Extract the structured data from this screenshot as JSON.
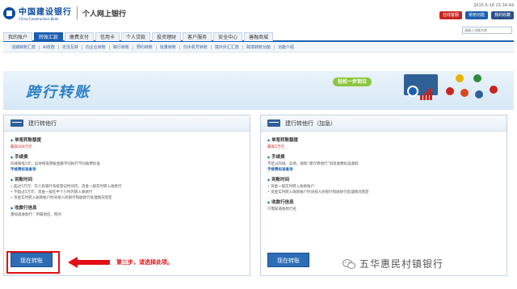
{
  "header": {
    "bank_name_cn": "中国建设银行",
    "bank_name_en": "China Construction Bank",
    "portal_title": "个人网上银行",
    "date": "2015-5-18 15:34:49",
    "buttons": [
      "在线客服",
      "常用功能",
      "我的收藏"
    ]
  },
  "nav": {
    "tabs": [
      "我的账户",
      "转账汇款",
      "缴费支付",
      "信用卡",
      "个人贷款",
      "投资理财",
      "客户服务",
      "安全中心",
      "善融商城"
    ],
    "active_index": 1,
    "search_placeholder": "请输入功能名称"
  },
  "subnav": {
    "items": [
      "活期转账汇款",
      "Al收款",
      "定活互转",
      "向企业转账",
      "跨行转账",
      "预约转账",
      "批量转账",
      "向手机号转账",
      "境外外汇汇款",
      "跨境转账功能",
      "功能介绍"
    ]
  },
  "banner": {
    "title": "跨行转账",
    "slogan": "轻松一步到位"
  },
  "left_panel": {
    "title": "建行转他行",
    "sections": [
      {
        "title": "单笔转账额度",
        "lines": [
          {
            "text": "最高200万元",
            "style": "red"
          }
        ]
      },
      {
        "title": "手续费",
        "lines": [
          {
            "text": "同城每笔5元；异地每笔转账金额不同执行不同收费标准",
            "style": "normal"
          },
          {
            "text": "手续费标准查询",
            "style": "link"
          }
        ]
      },
      {
        "title": "到账时间",
        "lines": [
          {
            "text": "超过5万元：在人民银行系统登记时间内，资金一般实时转入收款行",
            "style": "bullet"
          },
          {
            "text": "不超过5万元：资金一般在半个小时内转入收款行",
            "style": "bullet"
          },
          {
            "text": "资金实时转入收款账户时间视人民银行和收款行处理情况而定",
            "style": "bullet"
          }
        ]
      },
      {
        "title": "收款行信息",
        "lines": [
          {
            "text": "需知道收款行：所属地区、网点",
            "style": "normal"
          }
        ]
      }
    ],
    "button": "现在转账"
  },
  "right_panel": {
    "title": "建行转他行（加急）",
    "sections": [
      {
        "title": "单笔转账额度",
        "lines": [
          {
            "text": "最高5万元",
            "style": "red"
          }
        ]
      },
      {
        "title": "手续费",
        "lines": [
          {
            "text": "不区分同城、异地，按照“建行转他行”同等收费标准收取",
            "style": "normal"
          },
          {
            "text": "手续费标准查询",
            "style": "link"
          }
        ]
      },
      {
        "title": "到账时间",
        "lines": [
          {
            "text": "资金一般实时转入收款账户",
            "style": "bullet"
          },
          {
            "text": "资金实时转入收款账户时间视人民银行和收款行处理情况而定",
            "style": "bullet"
          }
        ]
      },
      {
        "title": "收款行信息",
        "lines": [
          {
            "text": "只需知道收款行名",
            "style": "normal"
          }
        ]
      }
    ],
    "button": "现在转账"
  },
  "annotation": {
    "text": "第三步，请选择此项。"
  },
  "watermark": {
    "text": "五华惠民村镇银行"
  },
  "colors": {
    "brand_blue": "#1b5fb0",
    "highlight_red": "#e30f14",
    "slogan_green": "#8cc63f"
  }
}
